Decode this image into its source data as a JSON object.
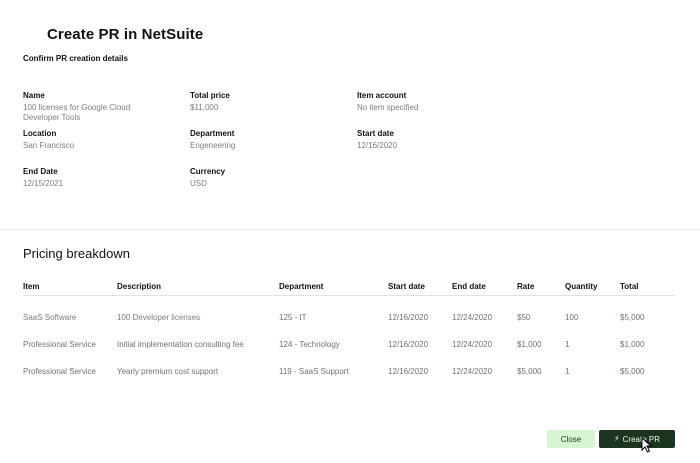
{
  "modal": {
    "title": "Create PR in NetSuite",
    "subtitle": "Confirm PR creation details"
  },
  "details": {
    "name": {
      "label": "Name",
      "value": "100 licenses for Google Cloud Developer Tools"
    },
    "total_price": {
      "label": "Total price",
      "value": "$11,000"
    },
    "item_account": {
      "label": "Item account",
      "value": "No item specified"
    },
    "location": {
      "label": "Location",
      "value": "San Francisco"
    },
    "department": {
      "label": "Department",
      "value": "Engeneering"
    },
    "start_date": {
      "label": "Start date",
      "value": "12/16/2020"
    },
    "end_date": {
      "label": "End Date",
      "value": "12/15/2021"
    },
    "currency": {
      "label": "Currency",
      "value": "USD"
    }
  },
  "pricing": {
    "title": "Pricing breakdown",
    "columns": [
      "Item",
      "Description",
      "Department",
      "Start date",
      "End date",
      "Rate",
      "Quantity",
      "Total"
    ],
    "rows": [
      [
        "SaaS Software",
        "100 Developer licenses",
        "125 - IT",
        "12/16/2020",
        "12/24/2020",
        "$50",
        "100",
        "$5,000"
      ],
      [
        "Professional Service",
        "Initial implementation consulting fee",
        "124 - Technology",
        "12/16/2020",
        "12/24/2020",
        "$1,000",
        "1",
        "$1,000"
      ],
      [
        "Professional Service",
        "Yearly premium cost support",
        "119 - SaaS Support",
        "12/16/2020",
        "12/24/2020",
        "$5,000",
        "1",
        "$5,000"
      ]
    ]
  },
  "actions": {
    "close_label": "Close",
    "create_label": "Create PR",
    "create_icon": "lightning-bolt-icon"
  },
  "colors": {
    "close_bg": "#d8f5d3",
    "create_bg": "#1c3520"
  }
}
